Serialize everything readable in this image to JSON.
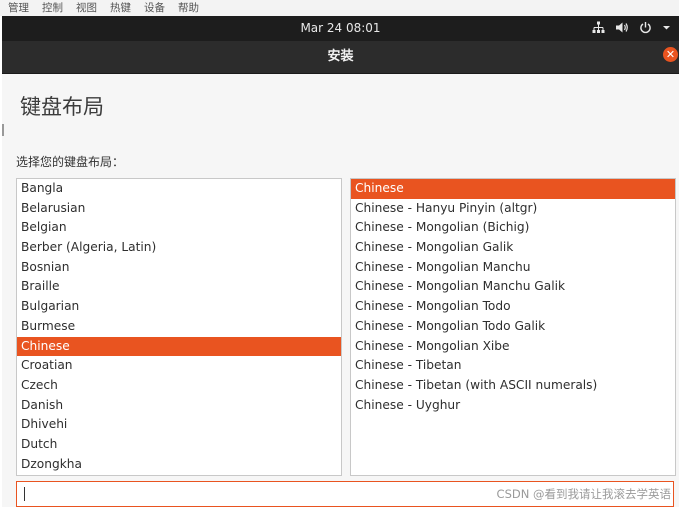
{
  "host_menu": [
    "管理",
    "控制",
    "视图",
    "热键",
    "设备",
    "帮助"
  ],
  "top_panel": {
    "clock": "Mar 24  08:01",
    "icons": [
      "network-icon",
      "volume-icon",
      "power-icon",
      "chevron-down-icon"
    ]
  },
  "window": {
    "title": "安装",
    "close_icon": "close-icon"
  },
  "page": {
    "title": "键盘布局",
    "prompt": "选择您的键盘布局："
  },
  "layouts": {
    "selected": "Chinese",
    "items": [
      "Bangla",
      "Belarusian",
      "Belgian",
      "Berber (Algeria, Latin)",
      "Bosnian",
      "Braille",
      "Bulgarian",
      "Burmese",
      "Chinese",
      "Croatian",
      "Czech",
      "Danish",
      "Dhivehi",
      "Dutch",
      "Dzongkha"
    ]
  },
  "variants": {
    "selected": "Chinese",
    "items": [
      "Chinese",
      "Chinese - Hanyu Pinyin (altgr)",
      "Chinese - Mongolian (Bichig)",
      "Chinese - Mongolian Galik",
      "Chinese - Mongolian Manchu",
      "Chinese - Mongolian Manchu Galik",
      "Chinese - Mongolian Todo",
      "Chinese - Mongolian Todo Galik",
      "Chinese - Mongolian Xibe",
      "Chinese - Tibetan",
      "Chinese - Tibetan (with ASCII numerals)",
      "Chinese - Uyghur"
    ]
  },
  "test_input": {
    "value": ""
  },
  "watermark": "CSDN @看到我请让我滚去学英语",
  "colors": {
    "accent": "#e95420",
    "panel": "#1d1d1d",
    "header": "#2c2c2c"
  }
}
